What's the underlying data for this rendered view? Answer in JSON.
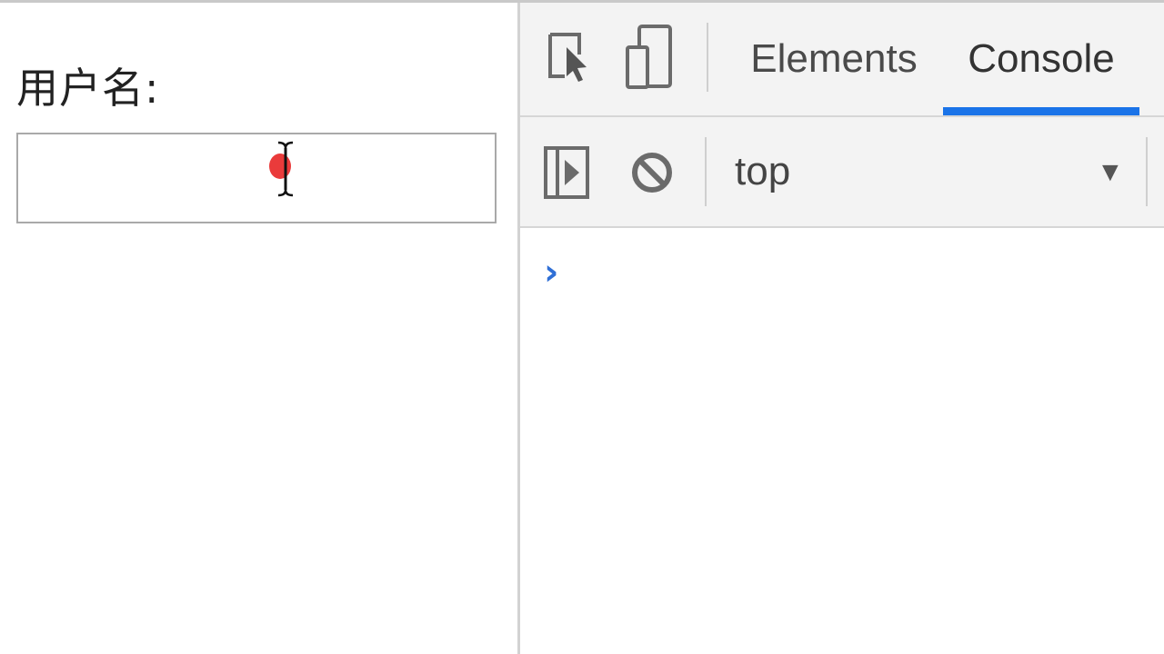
{
  "page": {
    "label": "用户名:",
    "input_value": ""
  },
  "devtools": {
    "tabs": [
      {
        "label": "Elements",
        "active": false
      },
      {
        "label": "Console",
        "active": true
      }
    ],
    "toolbar": {
      "context": "top"
    },
    "console": {
      "prompt": "›"
    },
    "icons": {
      "inspect": "inspect-element-icon",
      "device": "device-toolbar-icon",
      "sidebar": "console-sidebar-icon",
      "clear": "clear-console-icon",
      "dropdown": "dropdown-arrow-icon"
    },
    "colors": {
      "accent": "#1a73e8",
      "cursor_highlight": "#ea3b3b"
    }
  }
}
